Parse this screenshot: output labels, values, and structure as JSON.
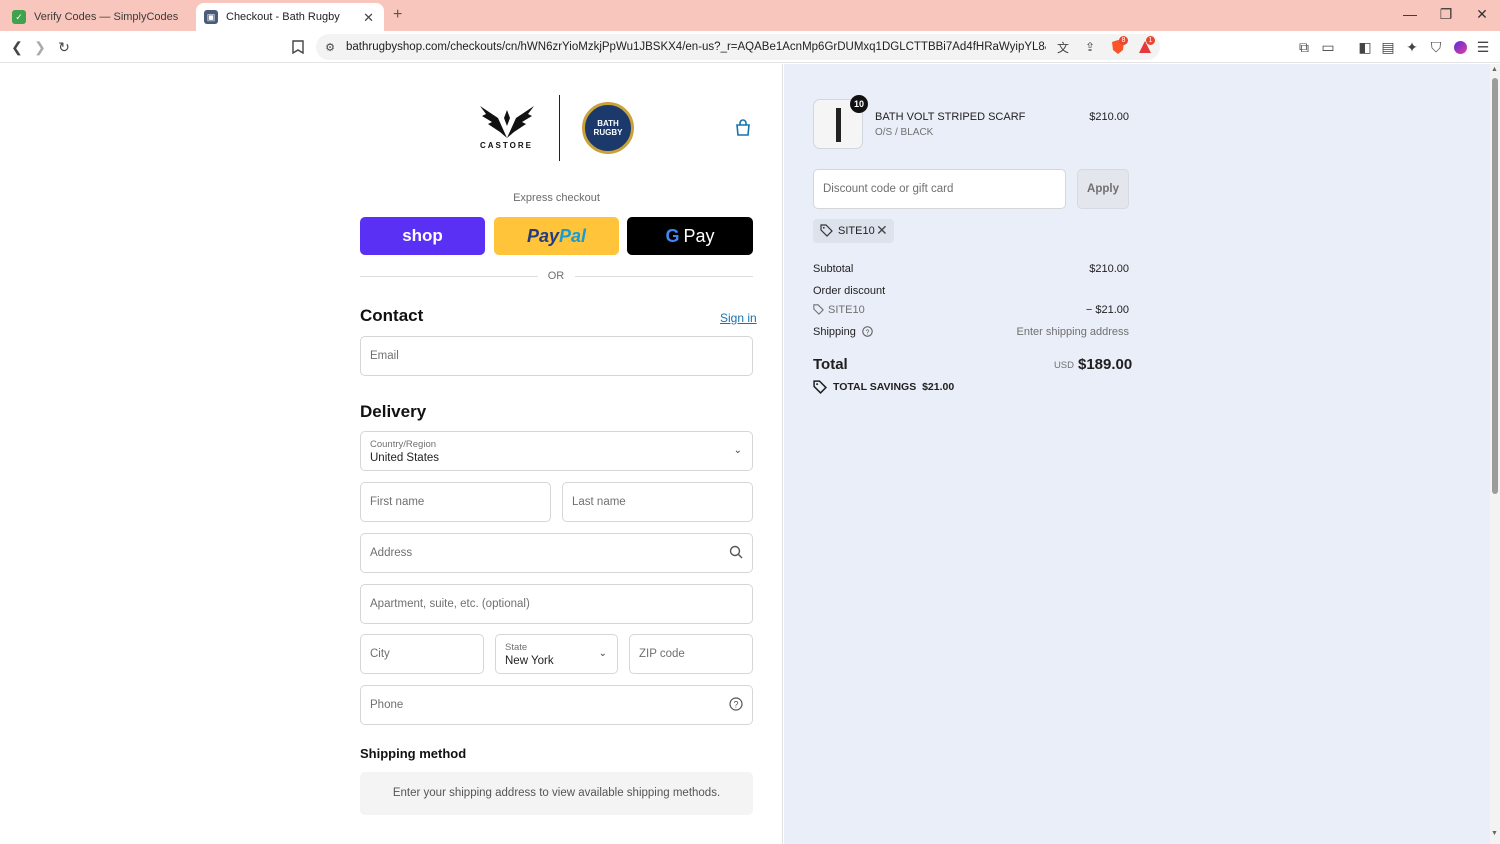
{
  "browser": {
    "tabs": [
      {
        "title": "Verify Codes — SimplyCodes",
        "favicon": "simplycodes-icon"
      },
      {
        "title": "Checkout - Bath Rugby",
        "favicon": "bath-rugby-icon"
      }
    ],
    "url": "bathrugbyshop.com/checkouts/cn/hWN6zrYioMzkjPpWu1JBSKX4/en-us?_r=AQABe1AcnMp6GrDUMxq1DGLCTTBBi7Ad4fHRaWyipYL8&auto_re...",
    "brave_badge": "8",
    "rewards_badge": "1",
    "accent_color": "#f9c6bd"
  },
  "brand": {
    "castore": "CASTORE",
    "crest": "BATH RUGBY"
  },
  "express": {
    "label": "Express checkout",
    "shop": "shop",
    "paypal_a": "Pay",
    "paypal_b": "Pal",
    "gpay_g": "G",
    "gpay": "Pay",
    "or": "OR"
  },
  "contact": {
    "heading": "Contact",
    "signin": "Sign in",
    "email_placeholder": "Email"
  },
  "delivery": {
    "heading": "Delivery",
    "country_label": "Country/Region",
    "country_value": "United States",
    "first_name": "First name",
    "last_name": "Last name",
    "address": "Address",
    "apartment": "Apartment, suite, etc. (optional)",
    "city": "City",
    "state_label": "State",
    "state_value": "New York",
    "zip": "ZIP code",
    "phone": "Phone"
  },
  "shipping_method": {
    "heading": "Shipping method",
    "note": "Enter your shipping address to view available shipping methods."
  },
  "summary": {
    "product": {
      "name": "BATH VOLT STRIPED SCARF",
      "variant": "O/S / BLACK",
      "price": "$210.00",
      "quantity": "10"
    },
    "discount_placeholder": "Discount code or gift card",
    "apply": "Apply",
    "applied_code": "SITE10",
    "subtotal_label": "Subtotal",
    "subtotal_value": "$210.00",
    "order_discount_label": "Order discount",
    "discount_code": "SITE10",
    "discount_value": "− $21.00",
    "shipping_label": "Shipping",
    "shipping_value": "Enter shipping address",
    "total_label": "Total",
    "currency": "USD",
    "total_value": "$189.00",
    "savings_label": "TOTAL SAVINGS",
    "savings_value": "$21.00"
  }
}
